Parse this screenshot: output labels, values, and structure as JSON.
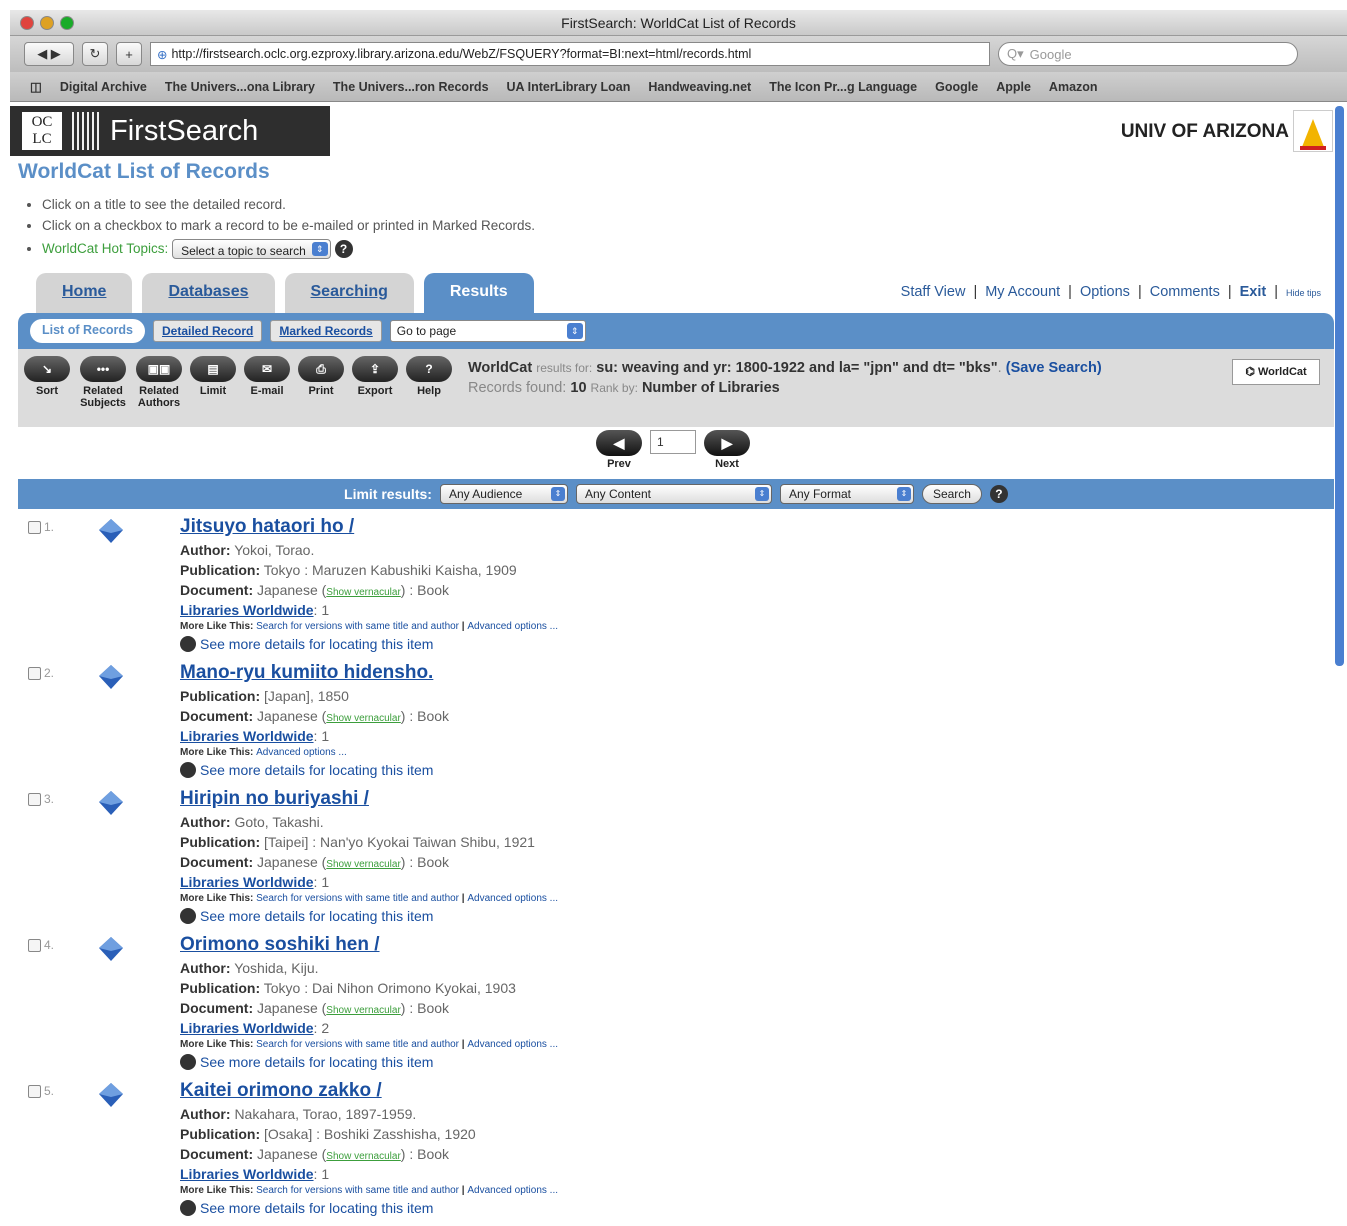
{
  "window": {
    "title": "FirstSearch: WorldCat List of Records"
  },
  "browser": {
    "url": "http://firstsearch.oclc.org.ezproxy.library.arizona.edu/WebZ/FSQUERY?format=BI:next=html/records.html",
    "search_placeholder": "Google",
    "bookmarks": [
      "Digital Archive",
      "The Univers...ona Library",
      "The Univers...ron Records",
      "UA InterLibrary Loan",
      "Handweaving.net",
      "The Icon Pr...g Language",
      "Google",
      "Apple",
      "Amazon"
    ]
  },
  "header": {
    "logo_oclc": "OC LC",
    "logo_title": "FirstSearch",
    "institution": "UNIV OF ARIZONA"
  },
  "page": {
    "title": "WorldCat List of Records",
    "instructions": [
      "Click on a title to see the detailed record.",
      "Click on a checkbox to mark a record to be e-mailed or printed in Marked Records."
    ],
    "hot_topics_label": "WorldCat Hot Topics:",
    "hot_topics_select": "Select a topic to search"
  },
  "tabs": [
    "Home",
    "Databases",
    "Searching",
    "Results"
  ],
  "toplinks": [
    "Staff View",
    "My Account",
    "Options",
    "Comments",
    "Exit",
    "Hide tips"
  ],
  "subnav": {
    "active": "List of Records",
    "items": [
      "Detailed Record",
      "Marked Records"
    ],
    "goto": "Go to page"
  },
  "tools": [
    {
      "label": "Sort",
      "icon": "sort-icon"
    },
    {
      "label": "Related Subjects",
      "icon": "related-subjects-icon"
    },
    {
      "label": "Related Authors",
      "icon": "related-authors-icon"
    },
    {
      "label": "Limit",
      "icon": "limit-icon"
    },
    {
      "label": "E-mail",
      "icon": "email-icon"
    },
    {
      "label": "Print",
      "icon": "print-icon"
    },
    {
      "label": "Export",
      "icon": "export-icon"
    },
    {
      "label": "Help",
      "icon": "help-icon"
    }
  ],
  "results_info": {
    "db": "WorldCat",
    "results_for": "results for:",
    "query": "su: weaving and yr: 1800-1922 and la= \"jpn\" and dt= \"bks\"",
    "save": "(Save Search)",
    "records_found_label": "Records found:",
    "records_found": "10",
    "rank_label": "Rank by:",
    "rank": "Number of Libraries",
    "worldcat_button": "WorldCat"
  },
  "pager": {
    "prev": "Prev",
    "next": "Next",
    "page": "1"
  },
  "limit": {
    "label": "Limit results:",
    "audience": "Any Audience",
    "content": "Any Content",
    "format": "Any Format",
    "search": "Search"
  },
  "labels": {
    "author": "Author:",
    "publication": "Publication:",
    "document": "Document:",
    "libraries": "Libraries Worldwide",
    "show_vernacular": "Show vernacular",
    "more_like": "More Like This:",
    "same_title": "Search for versions with same title and author",
    "advanced": "Advanced options ...",
    "details": "See more details for locating this item"
  },
  "records": [
    {
      "num": "1.",
      "title": "Jitsuyo hataori ho /",
      "author": "Yokoi, Torao.",
      "publication": "Tokyo : Maruzen Kabushiki Kaisha, 1909",
      "document": "Japanese",
      "doc_type": "Book",
      "libraries": "1",
      "same_title": true
    },
    {
      "num": "2.",
      "title": "Mano-ryu kumiito hidensho.",
      "author": "",
      "publication": "[Japan], 1850",
      "document": "Japanese",
      "doc_type": "Book",
      "libraries": "1",
      "same_title": false
    },
    {
      "num": "3.",
      "title": "Hiripin no buriyashi /",
      "author": "Goto, Takashi.",
      "publication": "[Taipei] : Nan'yo Kyokai Taiwan Shibu, 1921",
      "document": "Japanese",
      "doc_type": "Book",
      "libraries": "1",
      "same_title": true
    },
    {
      "num": "4.",
      "title": "Orimono soshiki hen /",
      "author": "Yoshida, Kiju.",
      "publication": "Tokyo : Dai Nihon Orimono Kyokai, 1903",
      "document": "Japanese",
      "doc_type": "Book",
      "libraries": "2",
      "same_title": true
    },
    {
      "num": "5.",
      "title": "Kaitei orimono zakko /",
      "author": "Nakahara, Torao, 1897-1959.",
      "publication": "[Osaka] : Boshiki Zasshisha, 1920",
      "document": "Japanese",
      "doc_type": "Book",
      "libraries": "1",
      "same_title": true
    }
  ]
}
